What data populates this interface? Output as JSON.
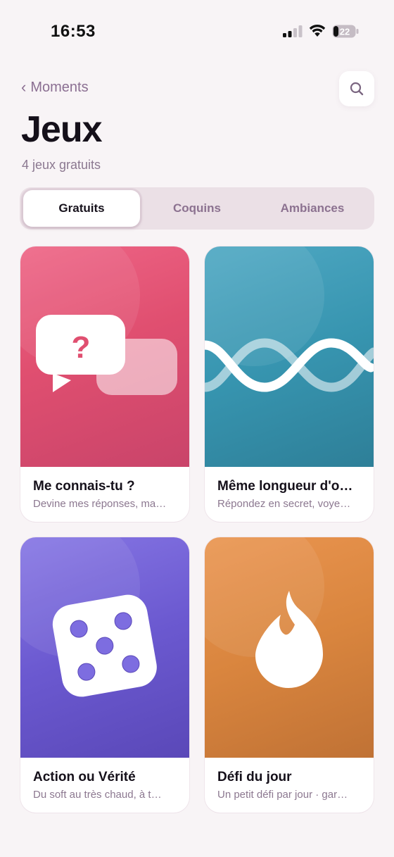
{
  "status_bar": {
    "time": "16:53",
    "battery": "22"
  },
  "header": {
    "back_label": "Moments",
    "title": "Jeux",
    "subtitle": "4 jeux gratuits"
  },
  "tabs": [
    {
      "label": "Gratuits",
      "active": true
    },
    {
      "label": "Coquins",
      "active": false
    },
    {
      "label": "Ambiances",
      "active": false
    }
  ],
  "cards": [
    {
      "title": "Me connais-tu ?",
      "description": "Devine mes réponses, ma…",
      "icon": "speech-bubbles-question-icon",
      "color": "#e04f70"
    },
    {
      "title": "Même longueur d'o…",
      "description": "Répondez en secret, voye…",
      "icon": "wave-icon",
      "color": "#3795b0"
    },
    {
      "title": "Action ou Vérité",
      "description": "Du soft au très chaud, à t…",
      "icon": "dice-icon",
      "color": "#6b59d0"
    },
    {
      "title": "Défi du jour",
      "description": "Un petit défi par jour · gar…",
      "icon": "flame-icon",
      "color": "#d9853e"
    }
  ],
  "colors": {
    "background": "#f8f4f6",
    "accent_text": "#8b6f92"
  }
}
